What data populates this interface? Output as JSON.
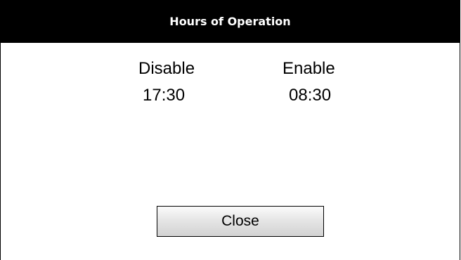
{
  "dialog": {
    "title": "Hours of Operation",
    "disable": {
      "label": "Disable",
      "time": "17:30"
    },
    "enable": {
      "label": "Enable",
      "time": "08:30"
    },
    "close_label": "Close"
  },
  "colors": {
    "title_bar_bg": "#000000",
    "title_text": "#ffffff",
    "body_bg": "#ffffff",
    "button_gradient_top": "#fbfbfb",
    "button_gradient_bottom": "#d2d2d2"
  }
}
